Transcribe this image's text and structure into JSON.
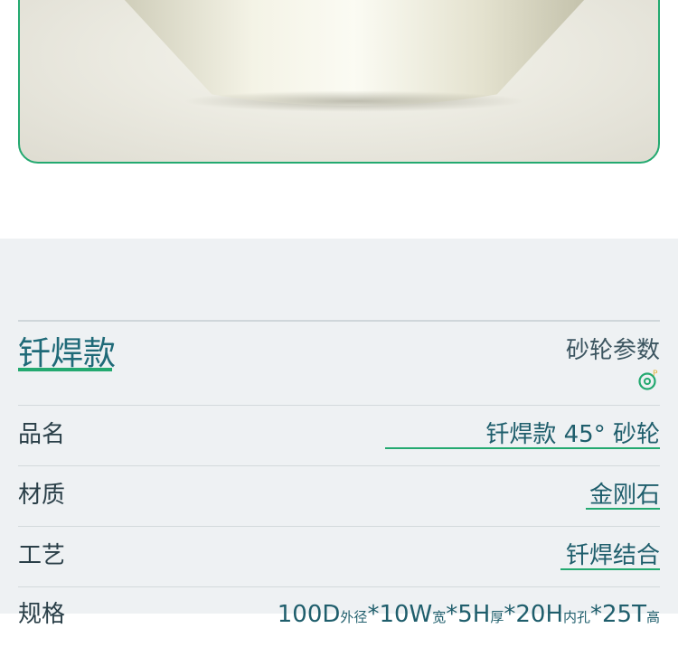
{
  "product": {
    "title": "钎焊款",
    "params_label": "砂轮参数",
    "rows": [
      {
        "label": "品名",
        "value": "钎焊款 45° 砂轮"
      },
      {
        "label": "材质",
        "value": "金刚石"
      },
      {
        "label": "工艺",
        "value": "钎焊结合"
      },
      {
        "label": "规格",
        "value_parts": [
          "100D",
          "外径",
          "*10W",
          "宽",
          "*5H",
          "厚",
          "*20H",
          "内孔",
          "*25T",
          "高"
        ]
      }
    ]
  },
  "colors": {
    "accent": "#23a970",
    "title": "#1f6a78",
    "panel_bg": "#eef1f3"
  },
  "icons": {
    "param_icon": "grinding-wheel-icon"
  }
}
